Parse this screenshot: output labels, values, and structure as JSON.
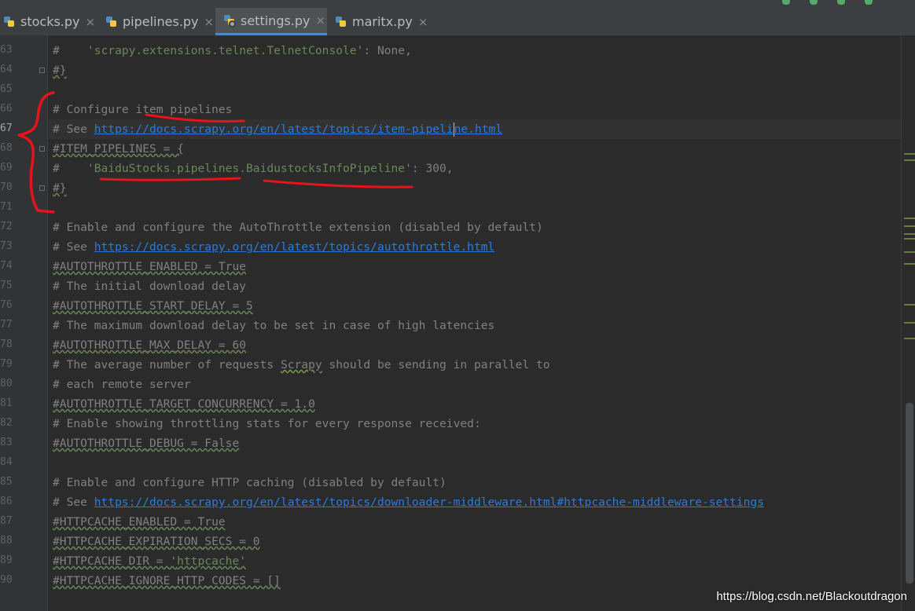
{
  "tabs": [
    {
      "label": "stocks.py",
      "active": false,
      "icon": "python-file-icon"
    },
    {
      "label": "pipelines.py",
      "active": false,
      "icon": "python-file-icon"
    },
    {
      "label": "settings.py",
      "active": true,
      "icon": "python-settings-file-icon"
    },
    {
      "label": "maritx.py",
      "active": false,
      "icon": "python-file-icon"
    }
  ],
  "tab_close_glyph": "×",
  "editor": {
    "lines": [
      {
        "n": "63",
        "text": "#    'scrapy.extensions.telnet.TelnetConsole': None,"
      },
      {
        "n": "64",
        "text": "#}"
      },
      {
        "n": "65",
        "text": ""
      },
      {
        "n": "66",
        "text": "# Configure item pipelines"
      },
      {
        "n": "67",
        "text": "# See https://docs.scrapy.org/en/latest/topics/item-pipeline.html"
      },
      {
        "n": "68",
        "text": "#ITEM_PIPELINES = {"
      },
      {
        "n": "69",
        "text": "#    'BaiduStocks.pipelines.BaidustocksInfoPipeline': 300,"
      },
      {
        "n": "70",
        "text": "#}"
      },
      {
        "n": "71",
        "text": ""
      },
      {
        "n": "72",
        "text": "# Enable and configure the AutoThrottle extension (disabled by default)"
      },
      {
        "n": "73",
        "text": "# See https://docs.scrapy.org/en/latest/topics/autothrottle.html"
      },
      {
        "n": "74",
        "text": "#AUTOTHROTTLE_ENABLED = True"
      },
      {
        "n": "75",
        "text": "# The initial download delay"
      },
      {
        "n": "76",
        "text": "#AUTOTHROTTLE_START_DELAY = 5"
      },
      {
        "n": "77",
        "text": "# The maximum download delay to be set in case of high latencies"
      },
      {
        "n": "78",
        "text": "#AUTOTHROTTLE_MAX_DELAY = 60"
      },
      {
        "n": "79",
        "text": "# The average number of requests Scrapy should be sending in parallel to"
      },
      {
        "n": "80",
        "text": "# each remote server"
      },
      {
        "n": "81",
        "text": "#AUTOTHROTTLE_TARGET_CONCURRENCY = 1.0"
      },
      {
        "n": "82",
        "text": "# Enable showing throttling stats for every response received:"
      },
      {
        "n": "83",
        "text": "#AUTOTHROTTLE_DEBUG = False"
      },
      {
        "n": "84",
        "text": ""
      },
      {
        "n": "85",
        "text": "# Enable and configure HTTP caching (disabled by default)"
      },
      {
        "n": "86",
        "text": "# See https://docs.scrapy.org/en/latest/topics/downloader-middleware.html#httpcache-middleware-settings"
      },
      {
        "n": "87",
        "text": "#HTTPCACHE_ENABLED = True"
      },
      {
        "n": "88",
        "text": "#HTTPCACHE_EXPIRATION_SECS = 0"
      },
      {
        "n": "89",
        "text": "#HTTPCACHE_DIR = 'httpcache'"
      },
      {
        "n": "90",
        "text": "#HTTPCACHE_IGNORE_HTTP_CODES = []"
      }
    ],
    "current_line": "67"
  },
  "watermark": "https://blog.csdn.net/Blackoutdragon",
  "colors": {
    "background": "#2b2b2b",
    "comment": "#808080",
    "link": "#287bde",
    "string": "#6a8759",
    "annotation": "#e8121a",
    "tab_active_underline": "#4a88c7"
  }
}
